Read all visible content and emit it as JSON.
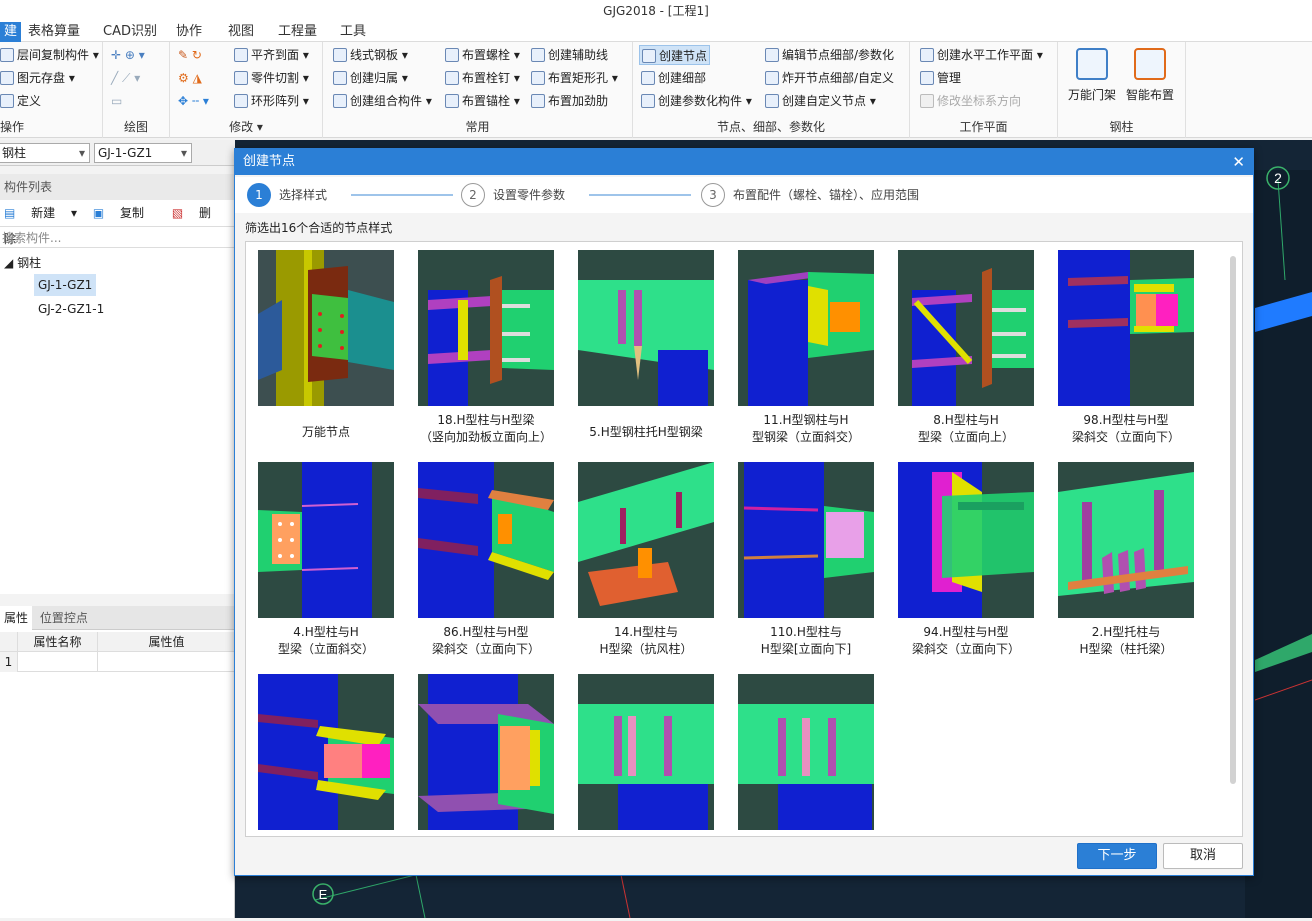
{
  "window": {
    "title": "GJG2018 - [工程1]"
  },
  "menu": {
    "items": [
      "建",
      "表格算量",
      "CAD识别",
      "协作",
      "视图",
      "工程量",
      "工具"
    ]
  },
  "ribbon": {
    "op": {
      "label": "操作",
      "items": [
        "层间复制构件",
        "图元存盘",
        "定义"
      ]
    },
    "draw": {
      "label": "绘图"
    },
    "modify": {
      "label": "修改",
      "items": [
        "平齐到面",
        "零件切割",
        "环形阵列"
      ]
    },
    "common": {
      "label": "常用",
      "items": [
        "线式钢板",
        "创建归属",
        "创建组合构件",
        "布置螺栓",
        "布置栓钉",
        "布置锚栓",
        "创建辅助线",
        "布置矩形孔",
        "布置加劲肋"
      ]
    },
    "nodes": {
      "label": "节点、细部、参数化",
      "items": [
        "创建节点",
        "创建细部",
        "创建参数化构件",
        "编辑节点细部/参数化",
        "炸开节点细部/自定义",
        "创建自定义节点"
      ]
    },
    "workplane": {
      "label": "工作平面",
      "items": [
        "创建水平工作平面",
        "管理",
        "修改坐标系方向"
      ]
    },
    "column": {
      "label": "钢柱",
      "items": [
        "万能门架",
        "智能布置"
      ]
    }
  },
  "selectors": {
    "type": "钢柱",
    "component": "GJ-1-GZ1"
  },
  "component_list": {
    "title": "构件列表",
    "toolbar": [
      "新建",
      "复制",
      "删除"
    ],
    "search_placeholder": "搜索构件...",
    "root": "钢柱",
    "items": [
      "GJ-1-GZ1",
      "GJ-2-GZ1-1"
    ]
  },
  "properties": {
    "tabs": [
      "属性",
      "位置控点"
    ],
    "headers": [
      "属性名称",
      "属性值"
    ],
    "rows": [
      "1"
    ]
  },
  "canvas": {
    "labels": [
      "2",
      "E"
    ]
  },
  "dialog": {
    "title": "创建节点",
    "steps": [
      {
        "num": "1",
        "label": "选择样式"
      },
      {
        "num": "2",
        "label": "设置零件参数"
      },
      {
        "num": "3",
        "label": "布置配件（螺栓、锚栓）、应用范围"
      }
    ],
    "filter_text": "筛选出16个合适的节点样式",
    "styles": [
      "万能节点",
      "18.H型柱与H型梁\n（竖向加劲板立面向上）",
      "5.H型钢柱托H型钢梁",
      "11.H型钢柱与H\n型钢梁（立面斜交）",
      "8.H型柱与H\n型梁（立面向上）",
      "98.H型柱与H型\n梁斜交（立面向下）",
      "4.H型柱与H\n型梁（立面斜交）",
      "86.H型柱与H型\n梁斜交（立面向下）",
      "14.H型柱与\nH型梁（抗风柱）",
      "110.H型柱与\nH型梁[立面向下]",
      "94.H型柱与H型\n梁斜交（立面向下）",
      "2.H型托柱与\nH型梁（柱托梁）",
      "",
      "",
      "",
      ""
    ],
    "next_button": "下一步",
    "cancel_button": "取消"
  }
}
